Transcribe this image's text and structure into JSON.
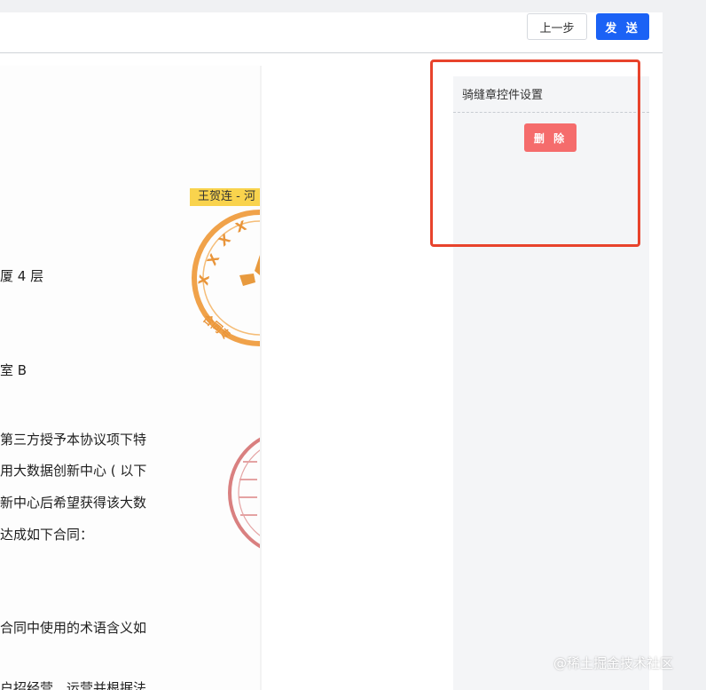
{
  "toolbar": {
    "prev_label": "上一步",
    "send_label": "发 送"
  },
  "document": {
    "lines": [
      "厦 4 层",
      "室 B",
      "第三方授予本协议项下特",
      "用大数据创新中心 ( 以下",
      "新中心后希望获得该大数",
      "达成如下合同：",
      "合同中使用的术语含义如",
      "户招经营、运营并根据法"
    ],
    "signer_tag": "王贺连 - 河",
    "seal_orange_text": "XXXX",
    "seal_orange_bottom": "合同专"
  },
  "side_panel": {
    "title": "骑缝章控件设置",
    "delete_label": "删 除"
  },
  "watermark": "@稀土掘金技术社区",
  "colors": {
    "primary": "#1b62f5",
    "danger": "#f56c6c",
    "highlight": "#e8432c",
    "seal_orange": "#f0a24a",
    "seal_red": "#d98080",
    "tag": "#f9d34d"
  }
}
